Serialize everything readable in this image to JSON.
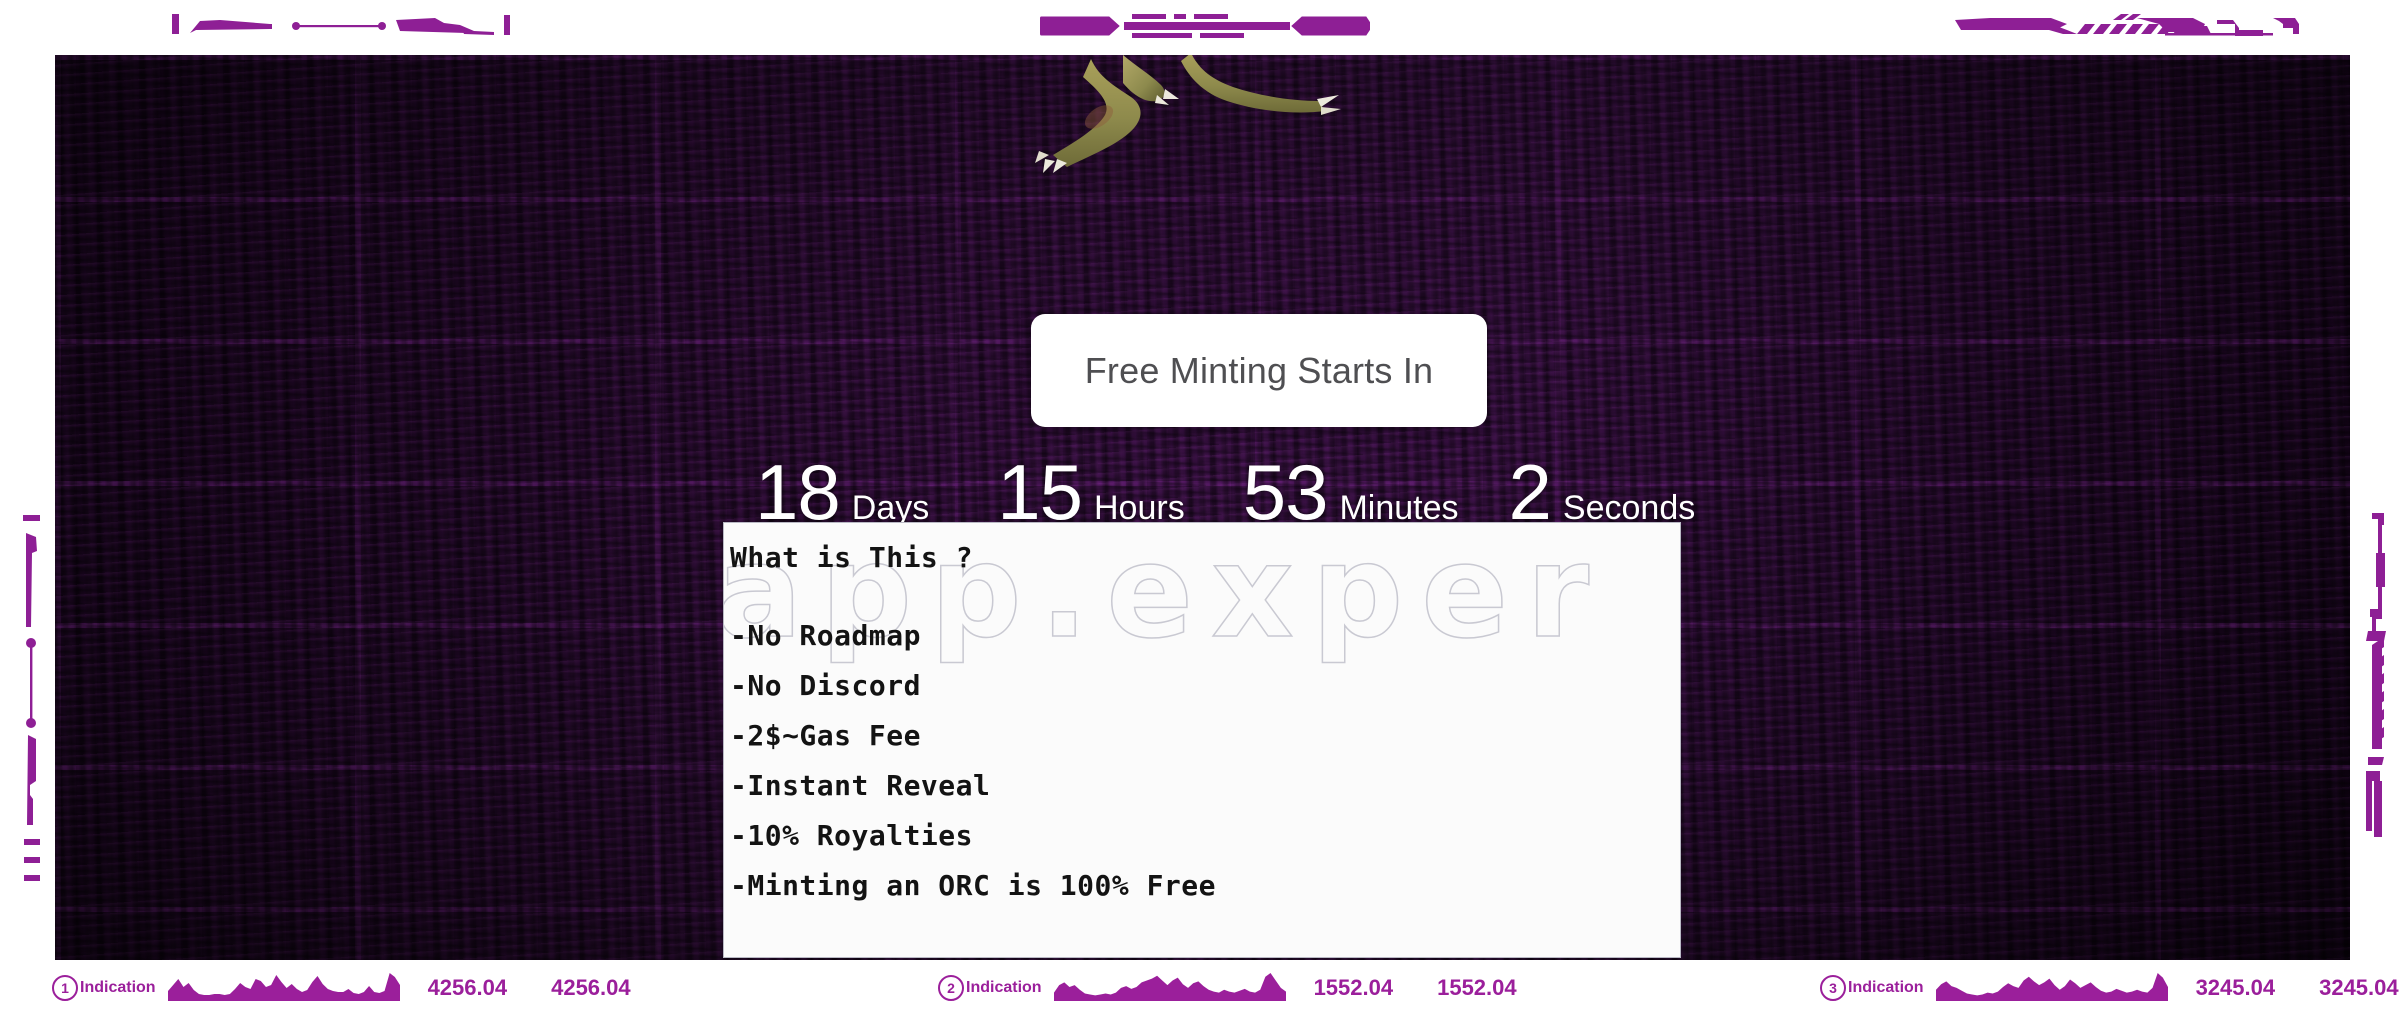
{
  "page": {
    "background_color": "#ffffff",
    "accent_color": "#9b1f9b",
    "wall_color": "#35103d"
  },
  "hero": {
    "headline": "Free Minting Starts In",
    "orc_image_name": "orc-claws-illustration"
  },
  "countdown": {
    "units": [
      {
        "value": "18",
        "label": "Days"
      },
      {
        "value": "15",
        "label": "Hours"
      },
      {
        "value": "53",
        "label": "Minutes"
      },
      {
        "value": "2",
        "label": "Seconds"
      }
    ]
  },
  "info_panel": {
    "watermark": "app.exper",
    "title": "What is This ?",
    "items": [
      "-No Roadmap",
      "-No Discord",
      "-2$~Gas Fee",
      "-Instant Reveal",
      "-10% Royalties",
      "-Minting an ORC is 100% Free"
    ]
  },
  "indicators": [
    {
      "number": "1",
      "label": "Indication",
      "value_left": "4256.04",
      "value_right": "4256.04",
      "sparkline": [
        10,
        16,
        22,
        14,
        18,
        11,
        7,
        6,
        6,
        7,
        7,
        6,
        7,
        12,
        18,
        14,
        12,
        22,
        20,
        14,
        16,
        26,
        19,
        13,
        17,
        12,
        9,
        11,
        19,
        25,
        17,
        12,
        10,
        9,
        9,
        12,
        8,
        7,
        9,
        15,
        9,
        8,
        10,
        28,
        24,
        16
      ]
    },
    {
      "number": "2",
      "label": "Indication",
      "value_left": "1552.04",
      "value_right": "1552.04",
      "sparkline": [
        9,
        17,
        20,
        15,
        17,
        12,
        8,
        7,
        6,
        7,
        8,
        7,
        9,
        14,
        16,
        13,
        15,
        20,
        22,
        24,
        27,
        22,
        17,
        22,
        25,
        18,
        14,
        19,
        21,
        16,
        12,
        10,
        9,
        12,
        10,
        9,
        11,
        13,
        10,
        9,
        12,
        26,
        30,
        22,
        14,
        10
      ]
    },
    {
      "number": "3",
      "label": "Indication",
      "value_left": "3245.04",
      "value_right": "3245.04",
      "sparkline": [
        12,
        18,
        21,
        16,
        14,
        11,
        8,
        7,
        6,
        7,
        9,
        8,
        10,
        15,
        19,
        16,
        14,
        22,
        26,
        21,
        17,
        20,
        24,
        17,
        12,
        16,
        23,
        19,
        14,
        17,
        20,
        15,
        11,
        9,
        10,
        13,
        11,
        9,
        10,
        12,
        10,
        9,
        14,
        30,
        25,
        15
      ]
    }
  ]
}
